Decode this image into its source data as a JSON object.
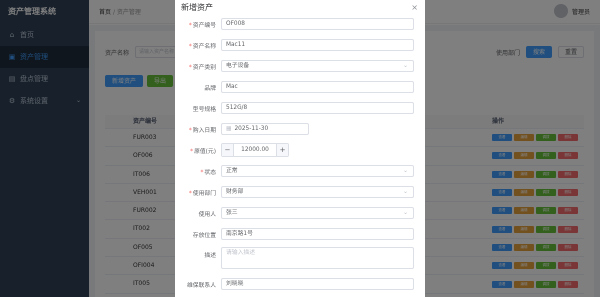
{
  "app": {
    "title": "资产管理系统"
  },
  "sidebar": {
    "items": [
      {
        "label": "首页",
        "icon": "home-icon"
      },
      {
        "label": "资产管理",
        "icon": "box-icon",
        "active": true
      },
      {
        "label": "盘点管理",
        "icon": "clipboard-icon"
      },
      {
        "label": "系统设置",
        "icon": "gear-icon"
      }
    ]
  },
  "header": {
    "breadcrumb": [
      "首页",
      "资产管理"
    ],
    "user": "管理员"
  },
  "search": {
    "name_label": "资产名称",
    "name_placeholder": "请输入资产名称",
    "dept_label": "使用部门",
    "search_btn": "搜索",
    "reset_btn": "重置"
  },
  "toolbar": {
    "add_btn": "新增资产",
    "export_btn": "导出"
  },
  "table": {
    "columns": [
      "资产编号",
      "操作"
    ],
    "rows": [
      "FUR003",
      "OF006",
      "IT006",
      "VEH001",
      "FUR002",
      "IT002",
      "OF005",
      "OFI004",
      "IT005"
    ],
    "ops": [
      "查看",
      "编辑",
      "调拨",
      "删除"
    ]
  },
  "dialog": {
    "title": "新增资产",
    "fields": [
      {
        "label": "资产编号",
        "required": true,
        "value": "OF008"
      },
      {
        "label": "资产名称",
        "required": true,
        "value": "Mac11"
      },
      {
        "label": "资产类别",
        "required": true,
        "value": "电子设备"
      },
      {
        "label": "品牌",
        "required": false,
        "value": "Mac"
      },
      {
        "label": "型号规格",
        "required": false,
        "value": "512G/8"
      },
      {
        "label": "购入日期",
        "required": true,
        "value": "2025-11-30"
      },
      {
        "label": "原值(元)",
        "required": true,
        "value": "12000.00"
      },
      {
        "label": "状态",
        "required": true,
        "value": "正常"
      },
      {
        "label": "使用部门",
        "required": true,
        "value": "财务部"
      },
      {
        "label": "使用人",
        "required": false,
        "value": "张三"
      },
      {
        "label": "存放位置",
        "required": false,
        "value": "南京路1号"
      },
      {
        "label": "描述",
        "required": false,
        "placeholder": "请输入描述"
      },
      {
        "label": "维保联系人",
        "required": false,
        "value": "刘晓晓"
      }
    ],
    "stepper_minus": "−",
    "stepper_plus": "+"
  }
}
